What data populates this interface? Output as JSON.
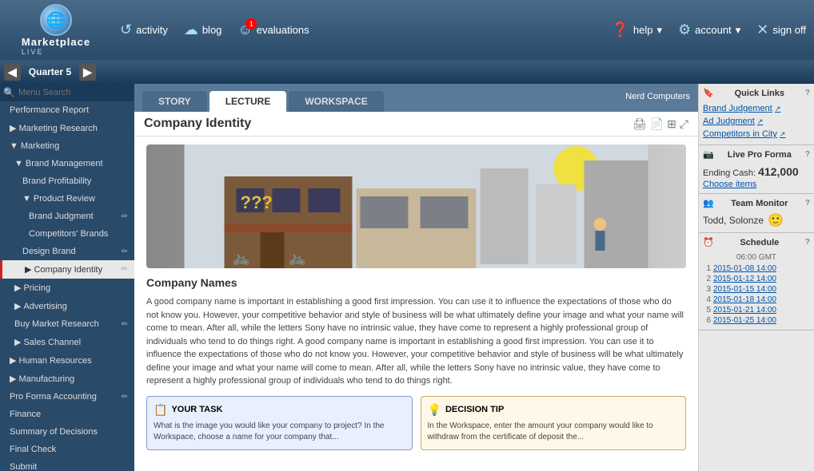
{
  "topbar": {
    "logo_text": "Marketplace",
    "logo_sub": "LIVE",
    "nav_items": [
      {
        "id": "activity",
        "label": "activity",
        "icon": "↺"
      },
      {
        "id": "blog",
        "label": "blog",
        "icon": "☁"
      },
      {
        "id": "evaluations",
        "label": "evaluations",
        "icon": "☺",
        "badge": "1"
      },
      {
        "id": "help",
        "label": "help",
        "icon": "?"
      },
      {
        "id": "account",
        "label": "account",
        "icon": "⚙"
      },
      {
        "id": "signoff",
        "label": "sign off",
        "icon": "✕"
      }
    ]
  },
  "quarter": {
    "label": "Quarter 5"
  },
  "sidebar": {
    "search_placeholder": "Menu Search",
    "items": [
      {
        "id": "performance-report",
        "label": "Performance Report",
        "level": 0,
        "expanded": false
      },
      {
        "id": "marketing-research",
        "label": "Marketing Research",
        "level": 0,
        "expanded": false
      },
      {
        "id": "marketing",
        "label": "Marketing",
        "level": 0,
        "expanded": true
      },
      {
        "id": "brand-management",
        "label": "Brand Management",
        "level": 1,
        "expanded": true
      },
      {
        "id": "brand-profitability",
        "label": "Brand Profitability",
        "level": 2,
        "expanded": false
      },
      {
        "id": "product-review",
        "label": "Product Review",
        "level": 2,
        "expanded": true
      },
      {
        "id": "brand-judgment",
        "label": "Brand Judgment",
        "level": 3,
        "expanded": false,
        "edit": true
      },
      {
        "id": "competitors-brands",
        "label": "Competitors' Brands",
        "level": 3,
        "expanded": false
      },
      {
        "id": "design-brand",
        "label": "Design Brand",
        "level": 2,
        "expanded": false,
        "edit": true
      },
      {
        "id": "company-identity",
        "label": "Company Identity",
        "level": 2,
        "expanded": false,
        "active": true,
        "edit": true
      },
      {
        "id": "pricing",
        "label": "Pricing",
        "level": 1,
        "expanded": false
      },
      {
        "id": "advertising",
        "label": "Advertising",
        "level": 1,
        "expanded": false
      },
      {
        "id": "buy-market-research",
        "label": "Buy Market Research",
        "level": 1,
        "expanded": false,
        "edit": true
      },
      {
        "id": "sales-channel",
        "label": "Sales Channel",
        "level": 1,
        "expanded": false
      },
      {
        "id": "human-resources",
        "label": "Human Resources",
        "level": 0,
        "expanded": false
      },
      {
        "id": "manufacturing",
        "label": "Manufacturing",
        "level": 0,
        "expanded": false
      },
      {
        "id": "pro-forma-accounting",
        "label": "Pro Forma Accounting",
        "level": 0,
        "expanded": false,
        "edit": true
      },
      {
        "id": "finance",
        "label": "Finance",
        "level": 0,
        "expanded": false
      },
      {
        "id": "summary-of-decisions",
        "label": "Summary of Decisions",
        "level": 0,
        "expanded": false
      },
      {
        "id": "final-check",
        "label": "Final Check",
        "level": 0,
        "expanded": false
      },
      {
        "id": "submit",
        "label": "Submit",
        "level": 0,
        "expanded": false
      }
    ]
  },
  "tabs": [
    {
      "id": "story",
      "label": "STORY"
    },
    {
      "id": "lecture",
      "label": "LECTURE",
      "active": true
    },
    {
      "id": "workspace",
      "label": "WORKSPACE"
    }
  ],
  "company_label": "Nerd Computers",
  "lecture": {
    "title": "Company Identity",
    "section_title": "Company Names",
    "body_text_1": "A good company name is important in establishing a good first impression. You can use it to influence the expectations of those who do not know you. However, your competitive behavior and style of business will be what ultimately define your image and what your name will come to mean. After all, while the letters Sony have no intrinsic value, they have come to represent a highly professional group of individuals who tend to do things right. A good company name is important in establishing a good first impression. You can use it to influence the expectations of those who do not know you. However, your competitive behavior and style of business will be what ultimately define your image and what your name will come to mean. After all, while the letters Sony have no intrinsic value, they have come to represent a highly professional group of individuals who tend to do things right.",
    "your_task_label": "YOUR TASK",
    "your_task_text": "What is the image you would like your company to project? In the Workspace, choose a name for your company that...",
    "decision_tip_label": "DECISION TIP",
    "decision_tip_text": "In the Workspace, enter the amount your company would like to withdraw from the certificate of deposit the..."
  },
  "right_panel": {
    "quick_links_label": "Quick Links",
    "quick_links": [
      {
        "label": "Brand Judgement",
        "id": "brand-judgement-link"
      },
      {
        "label": "Ad Judgment",
        "id": "ad-judgment-link"
      },
      {
        "label": "Competitors in City",
        "id": "competitors-in-city-link"
      }
    ],
    "live_pro_forma_label": "Live Pro Forma",
    "ending_cash_label": "Ending Cash:",
    "ending_cash_value": "412,000",
    "choose_items_label": "Choose items",
    "team_monitor_label": "Team Monitor",
    "team_name": "Todd, Solonze",
    "schedule_label": "Schedule",
    "schedule_gmt": "06:00 GMT",
    "schedule_rows": [
      {
        "num": "1",
        "date": "2015-01-08 14:00"
      },
      {
        "num": "2",
        "date": "2015-01-12 14:00"
      },
      {
        "num": "3",
        "date": "2015-01-15 14:00"
      },
      {
        "num": "4",
        "date": "2015-01-18 14:00"
      },
      {
        "num": "5",
        "date": "2015-01-21 14:00"
      },
      {
        "num": "6",
        "date": "2015-01-25 14:00"
      }
    ]
  }
}
